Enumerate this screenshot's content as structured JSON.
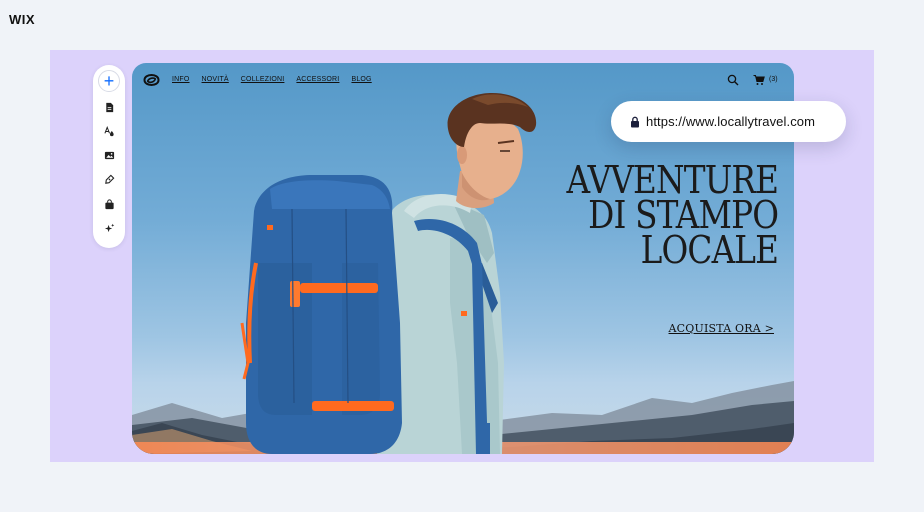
{
  "brand": {
    "logo_text": "WIX"
  },
  "toolbar": {
    "items": [
      {
        "name": "add-icon",
        "label": "+"
      },
      {
        "name": "page-icon"
      },
      {
        "name": "text-style-icon"
      },
      {
        "name": "image-icon"
      },
      {
        "name": "pen-icon"
      },
      {
        "name": "bag-icon"
      },
      {
        "name": "sparkle-icon"
      }
    ]
  },
  "site": {
    "nav": {
      "links": [
        "INFO",
        "NOVITÀ",
        "COLLEZIONI",
        "ACCESSORI",
        "BLOG"
      ],
      "cart_count": "(3)"
    },
    "hero": {
      "headline_lines": [
        "AVVENTURE",
        "DI STAMPO",
        "LOCALE"
      ],
      "cta": "ACQUISTA ORA >"
    }
  },
  "url_bar": {
    "url": "https://www.locallytravel.com"
  },
  "colors": {
    "page_bg": "#f0f3f8",
    "stage_bg": "#dcd2fb",
    "sky": "#5498c8",
    "accent_orange": "#ff7a2e",
    "backpack_blue": "#2f67a8",
    "jacket": "#b9d4d6"
  }
}
